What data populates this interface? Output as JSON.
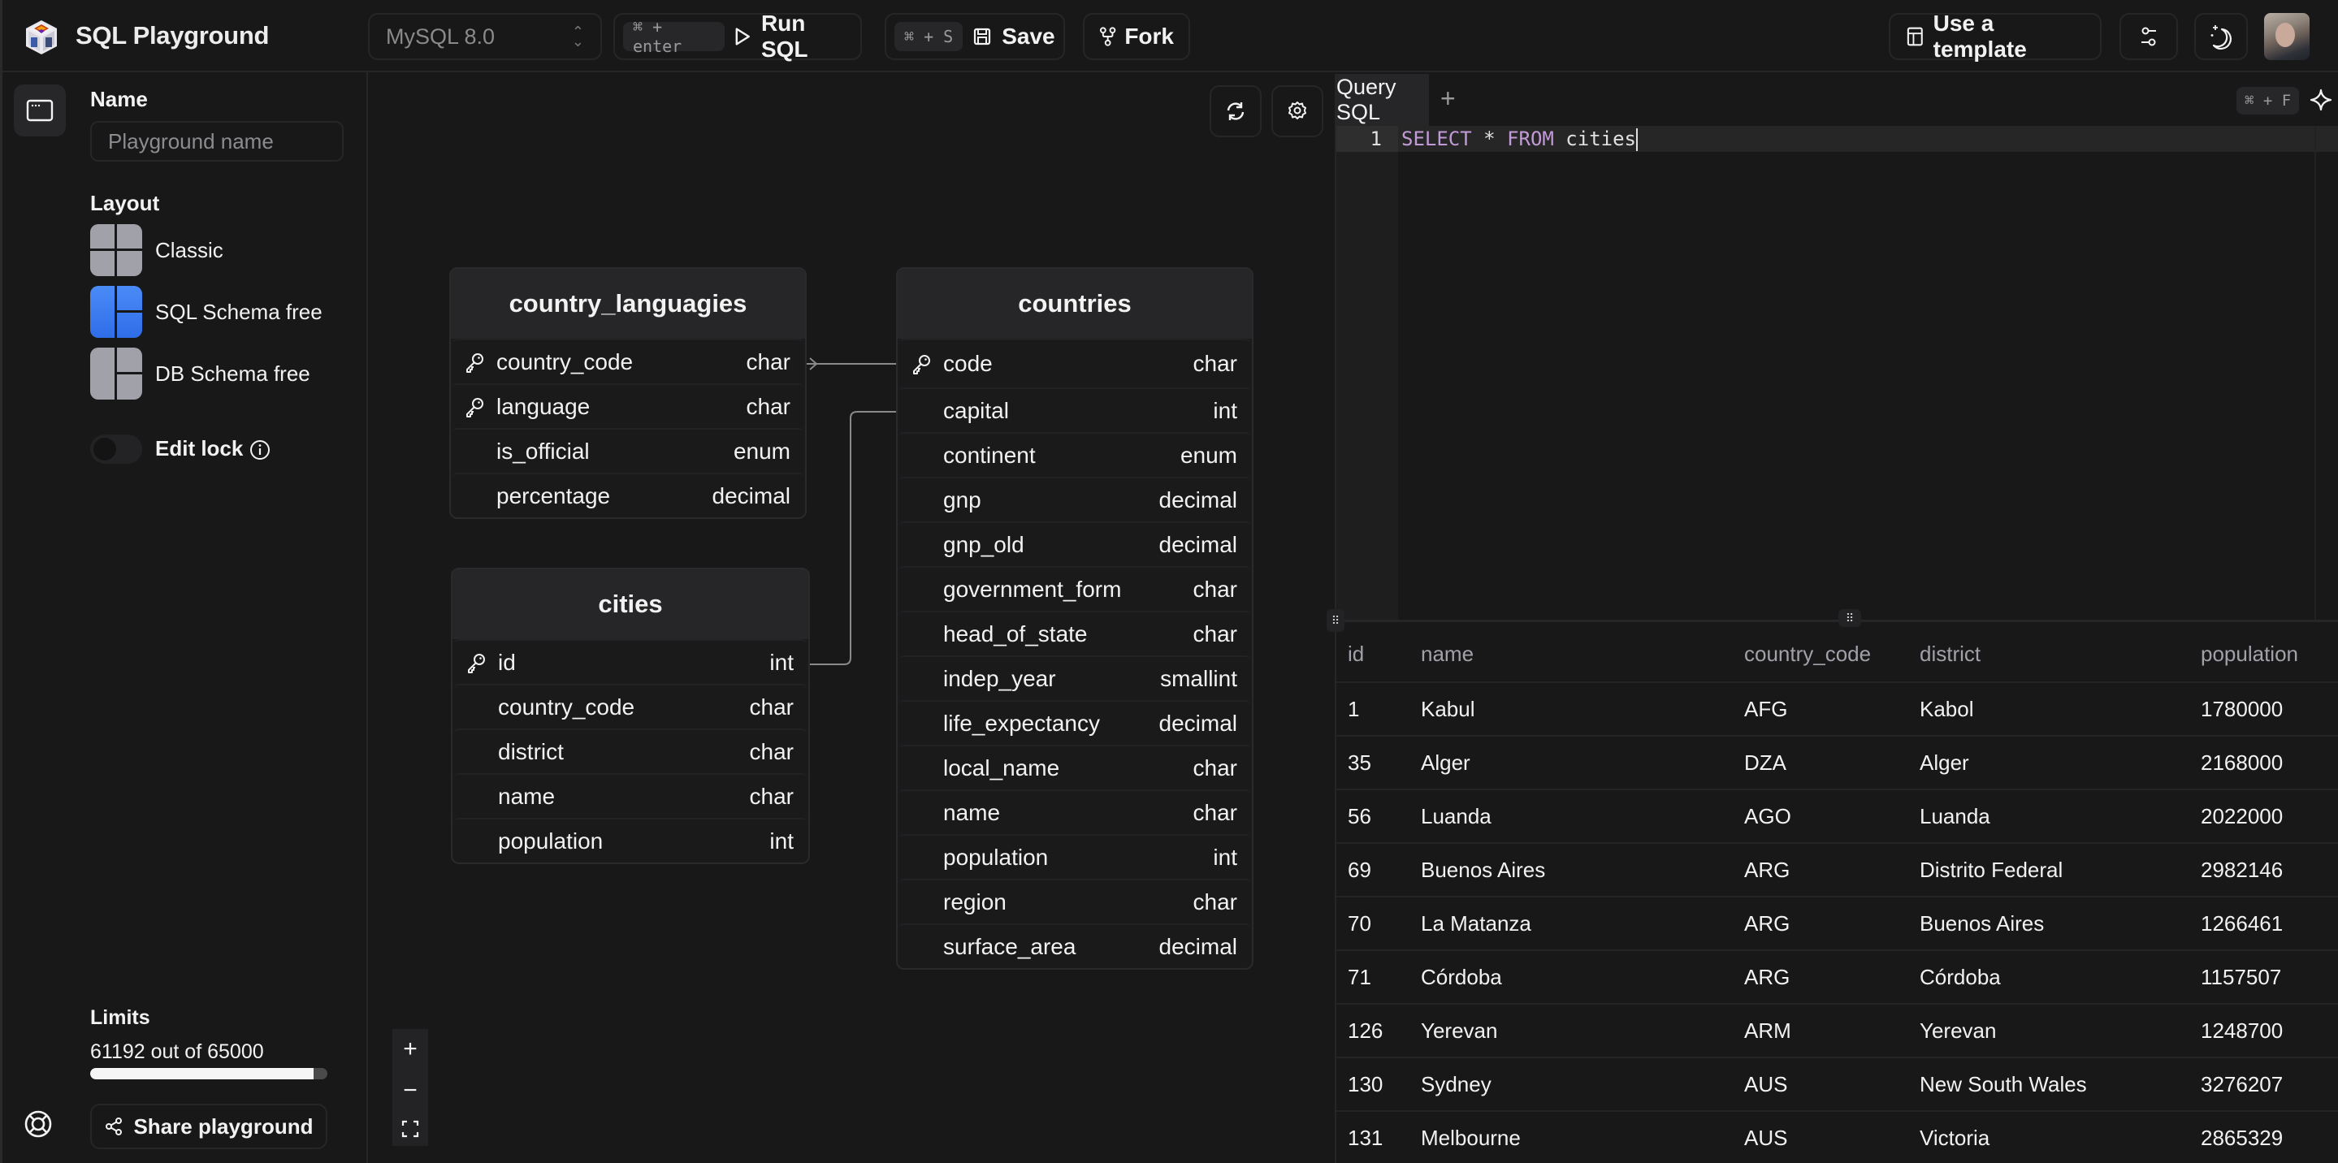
{
  "app": {
    "title": "SQL Playground",
    "logo_icon": "cube-logo-icon"
  },
  "toolbar": {
    "db_select": {
      "value": "MySQL 8.0",
      "icon": "chevrons-up-down-icon"
    },
    "run": {
      "shortcut": "⌘ + enter",
      "label": "Run SQL",
      "icon": "play-icon"
    },
    "save": {
      "shortcut": "⌘ + S",
      "label": "Save",
      "icon": "floppy-disk-icon"
    },
    "fork": {
      "label": "Fork",
      "icon": "git-fork-icon"
    },
    "template": {
      "label": "Use a template",
      "icon": "layout-template-icon"
    },
    "filters_icon": "sliders-icon",
    "theme_icon": "moon-stars-icon",
    "avatar": "user-avatar"
  },
  "sidebar": {
    "rail_icon": "app-window-icon",
    "help_icon": "life-buoy-icon",
    "name_label": "Name",
    "name_placeholder": "Playground name",
    "name_value": "",
    "layout_label": "Layout",
    "layouts": [
      {
        "label": "Classic",
        "active": false
      },
      {
        "label": "SQL Schema free",
        "active": true
      },
      {
        "label": "DB Schema free",
        "active": false
      }
    ],
    "edit_lock": {
      "label": "Edit lock",
      "enabled": false,
      "icon": "info-icon"
    },
    "limits": {
      "label": "Limits",
      "text": "61192 out of 65000",
      "used": 61192,
      "max": 65000
    },
    "share": {
      "label": "Share playground",
      "icon": "share-icon"
    }
  },
  "canvas": {
    "refresh_icon": "refresh-icon",
    "settings_icon": "gear-icon",
    "zoom_in": "+",
    "zoom_out": "−",
    "fit_icon": "fullscreen-icon",
    "tables": [
      {
        "name": "country_languagies",
        "columns": [
          {
            "name": "country_code",
            "type": "char",
            "key": true
          },
          {
            "name": "language",
            "type": "char",
            "key": true
          },
          {
            "name": "is_official",
            "type": "enum",
            "key": false
          },
          {
            "name": "percentage",
            "type": "decimal",
            "key": false
          }
        ]
      },
      {
        "name": "countries",
        "columns": [
          {
            "name": "code",
            "type": "char",
            "key": true
          },
          {
            "name": "capital",
            "type": "int",
            "key": false
          },
          {
            "name": "continent",
            "type": "enum",
            "key": false
          },
          {
            "name": "gnp",
            "type": "decimal",
            "key": false
          },
          {
            "name": "gnp_old",
            "type": "decimal",
            "key": false
          },
          {
            "name": "government_form",
            "type": "char",
            "key": false
          },
          {
            "name": "head_of_state",
            "type": "char",
            "key": false
          },
          {
            "name": "indep_year",
            "type": "smallint",
            "key": false
          },
          {
            "name": "life_expectancy",
            "type": "decimal",
            "key": false
          },
          {
            "name": "local_name",
            "type": "char",
            "key": false
          },
          {
            "name": "name",
            "type": "char",
            "key": false
          },
          {
            "name": "population",
            "type": "int",
            "key": false
          },
          {
            "name": "region",
            "type": "char",
            "key": false
          },
          {
            "name": "surface_area",
            "type": "decimal",
            "key": false
          }
        ]
      },
      {
        "name": "cities",
        "columns": [
          {
            "name": "id",
            "type": "int",
            "key": true
          },
          {
            "name": "country_code",
            "type": "char",
            "key": false
          },
          {
            "name": "district",
            "type": "char",
            "key": false
          },
          {
            "name": "name",
            "type": "char",
            "key": false
          },
          {
            "name": "population",
            "type": "int",
            "key": false
          }
        ]
      }
    ],
    "relations": [
      {
        "from": "country_languagies.country_code",
        "to": "countries.code"
      },
      {
        "from": "cities.id",
        "to": "countries.capital"
      }
    ]
  },
  "editor": {
    "tabs": [
      {
        "label": "Query SQL",
        "active": true
      }
    ],
    "add_tab": "+",
    "find_shortcut": "⌘ + F",
    "ai_icon": "sparkle-icon",
    "lines": [
      {
        "number": "1",
        "tokens": [
          {
            "text": "SELECT",
            "kw": true
          },
          {
            "text": " * ",
            "kw": false
          },
          {
            "text": "FROM",
            "kw": true
          },
          {
            "text": " cities",
            "kw": false
          }
        ]
      }
    ]
  },
  "results": {
    "columns": [
      "id",
      "name",
      "country_code",
      "district",
      "population"
    ],
    "rows": [
      [
        "1",
        "Kabul",
        "AFG",
        "Kabol",
        "1780000"
      ],
      [
        "35",
        "Alger",
        "DZA",
        "Alger",
        "2168000"
      ],
      [
        "56",
        "Luanda",
        "AGO",
        "Luanda",
        "2022000"
      ],
      [
        "69",
        "Buenos Aires",
        "ARG",
        "Distrito Federal",
        "2982146"
      ],
      [
        "70",
        "La Matanza",
        "ARG",
        "Buenos Aires",
        "1266461"
      ],
      [
        "71",
        "Córdoba",
        "ARG",
        "Córdoba",
        "1157507"
      ],
      [
        "126",
        "Yerevan",
        "ARM",
        "Yerevan",
        "1248700"
      ],
      [
        "130",
        "Sydney",
        "AUS",
        "New South Wales",
        "3276207"
      ],
      [
        "131",
        "Melbourne",
        "AUS",
        "Victoria",
        "2865329"
      ]
    ]
  }
}
